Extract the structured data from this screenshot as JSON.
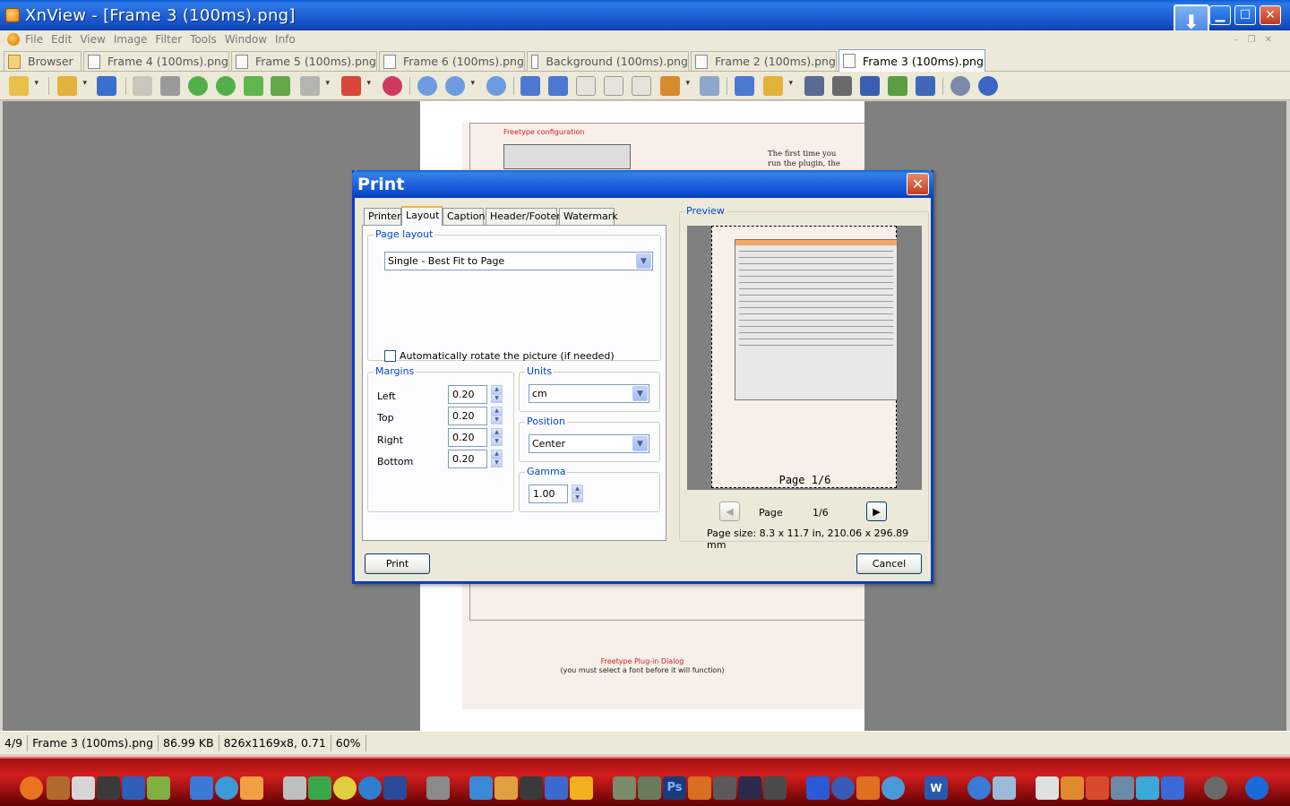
{
  "window": {
    "title": "XnView - [Frame 3 (100ms).png]"
  },
  "menu": [
    "File",
    "Edit",
    "View",
    "Image",
    "Filter",
    "Tools",
    "Window",
    "Info"
  ],
  "tabs": [
    {
      "label": "Browser"
    },
    {
      "label": "Frame 4 (100ms).png"
    },
    {
      "label": "Frame 5 (100ms).png"
    },
    {
      "label": "Frame 6 (100ms).png"
    },
    {
      "label": "Background (100ms).png"
    },
    {
      "label": "Frame 2 (100ms).png"
    },
    {
      "label": "Frame 3 (100ms).png"
    }
  ],
  "document": {
    "heading": "Freetype configuration",
    "side_text_line1": "The first time you",
    "side_text_line2": "run the plugin, the",
    "caption1": "Freetype Plug-in Dialog",
    "caption2": "(you must select a font before it will function)"
  },
  "status": {
    "index": "4/9",
    "filename": "Frame 3 (100ms).png",
    "filesize": "86.99 KB",
    "dimensions": "826x1169x8, 0.71",
    "zoom": "60%"
  },
  "dialog": {
    "title": "Print",
    "tabs": [
      "Printer",
      "Layout",
      "Caption",
      "Header/Footer",
      "Watermark"
    ],
    "active_tab": "Layout",
    "page_layout": {
      "group_title": "Page layout",
      "selected": "Single - Best Fit to Page",
      "auto_rotate_label": "Automatically rotate the picture (if needed)",
      "auto_rotate_checked": false
    },
    "margins": {
      "group_title": "Margins",
      "left_label": "Left",
      "left": "0.20",
      "top_label": "Top",
      "top": "0.20",
      "right_label": "Right",
      "right": "0.20",
      "bottom_label": "Bottom",
      "bottom": "0.20"
    },
    "units": {
      "group_title": "Units",
      "selected": "cm"
    },
    "position": {
      "group_title": "Position",
      "selected": "Center"
    },
    "gamma": {
      "group_title": "Gamma",
      "value": "1.00"
    },
    "preview": {
      "group_title": "Preview",
      "page_label": "Page 1/6",
      "nav_page_label": "Page",
      "nav_page_value": "1/6",
      "page_size": "Page size: 8.3 x 11.7 in, 210.06 x 296.89 mm"
    },
    "print_button": "Print",
    "cancel_button": "Cancel"
  },
  "colors": {
    "titlebar": "#1550c8",
    "taskbar": "#c01818",
    "group_title": "#0046d5"
  }
}
